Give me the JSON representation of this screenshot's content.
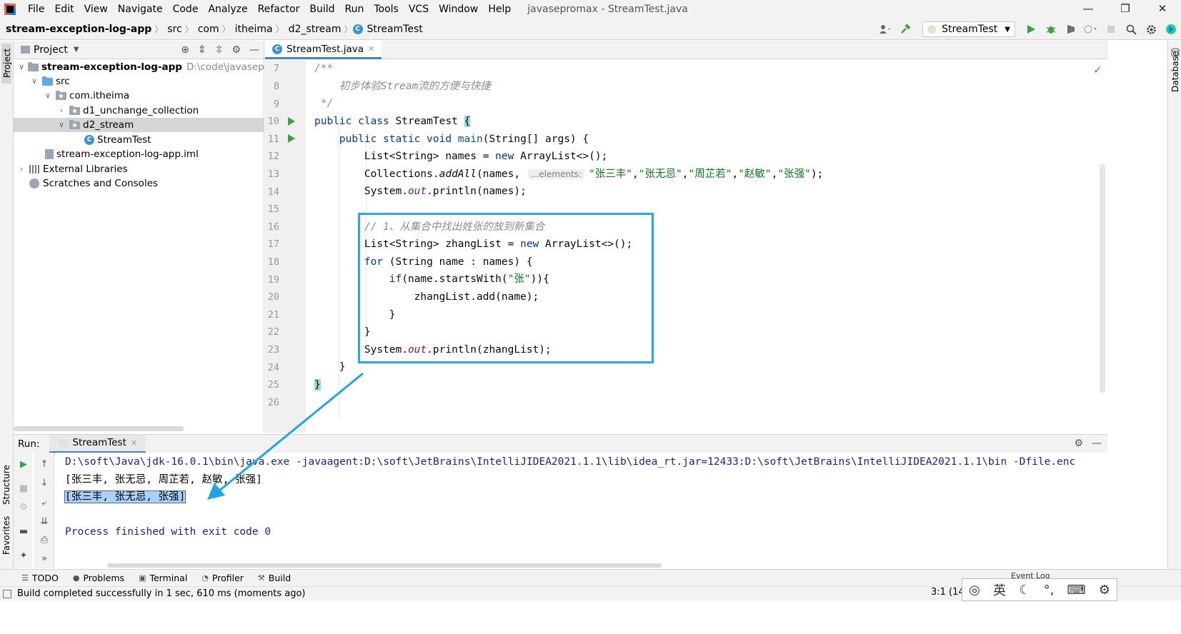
{
  "menubar": {
    "items": [
      "File",
      "Edit",
      "View",
      "Navigate",
      "Code",
      "Analyze",
      "Refactor",
      "Build",
      "Run",
      "Tools",
      "VCS",
      "Window",
      "Help"
    ],
    "window_title": "javasepromax - StreamTest.java",
    "minimize": "—",
    "restore": "❐",
    "close": "✕"
  },
  "breadcrumb": {
    "items": [
      "stream-exception-log-app",
      "src",
      "com",
      "itheima",
      "d2_stream",
      "StreamTest"
    ]
  },
  "toolbar": {
    "run_config": "StreamTest",
    "icons": [
      "user-icon",
      "build-hammer-icon",
      "run-icon",
      "debug-icon",
      "coverage-icon",
      "profile-icon",
      "stop-icon",
      "search-icon",
      "settings-icon",
      "jetbrains-icon"
    ]
  },
  "side_strips": {
    "left_top": "Project",
    "left_mid": "Structure",
    "left_bottom": "Favorites",
    "right_top": "Database"
  },
  "project": {
    "title": "Project",
    "tree": [
      {
        "label": "stream-exception-log-app",
        "suffix": "D:\\code\\javasepromax\\",
        "bold": true
      },
      {
        "label": "src"
      },
      {
        "label": "com.itheima"
      },
      {
        "label": "d1_unchange_collection"
      },
      {
        "label": "d2_stream"
      },
      {
        "label": "StreamTest"
      },
      {
        "label": "stream-exception-log-app.iml"
      },
      {
        "label": "External Libraries"
      },
      {
        "label": "Scratches and Consoles"
      }
    ]
  },
  "editor": {
    "tab": "StreamTest.java",
    "line_numbers": [
      "7",
      "8",
      "9",
      "10",
      "11",
      "12",
      "13",
      "14",
      "15",
      "16",
      "17",
      "18",
      "19",
      "20",
      "21",
      "22",
      "23",
      "24",
      "25",
      "26"
    ],
    "param_hint": "...elements:",
    "checkmark": "✓"
  },
  "run": {
    "label": "Run:",
    "tab": "StreamTest",
    "console": [
      "D:\\soft\\Java\\jdk-16.0.1\\bin\\java.exe -javaagent:D:\\soft\\JetBrains\\IntelliJIDEA2021.1.1\\lib\\idea_rt.jar=12433:D:\\soft\\JetBrains\\IntelliJIDEA2021.1.1\\bin -Dfile.enc",
      "[张三丰, 张无忌, 周芷若, 赵敏, 张强]",
      "[张三丰, 张无忌, 张强]",
      "",
      "Process finished with exit code 0"
    ]
  },
  "bottom_tools": [
    "TODO",
    "Problems",
    "Terminal",
    "Profiler",
    "Build"
  ],
  "status": {
    "message": "Build completed successfully in 1 sec, 610 ms (moments ago)",
    "position": "3:1 (14",
    "event_log": "Event Log"
  },
  "ime": {
    "lang": "英"
  },
  "colors": {
    "keyword": "#0033b3",
    "string": "#067d17",
    "comment": "#8c8c8c",
    "highlight_box": "#22aaee",
    "annotation_arrow": "#1ea7e8",
    "selection": "#a6d2ff"
  }
}
